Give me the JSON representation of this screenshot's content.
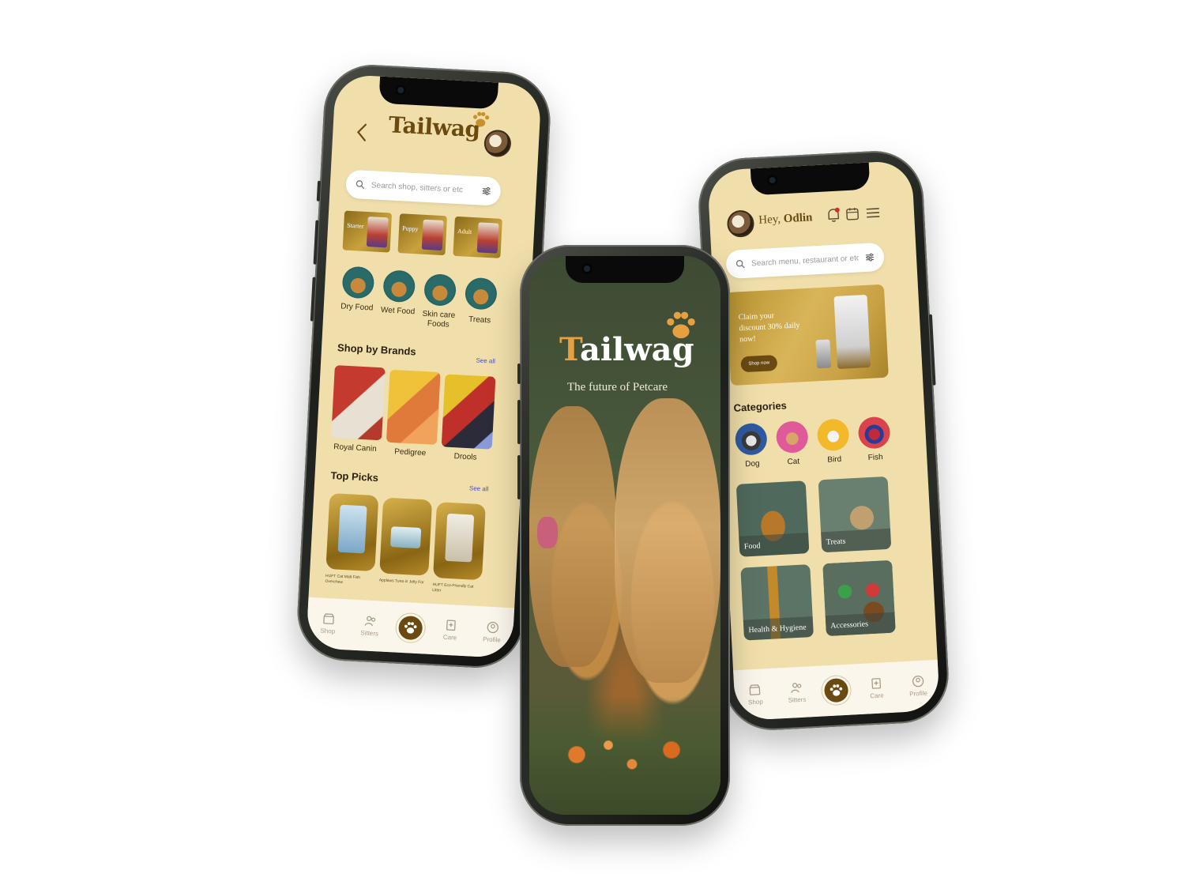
{
  "shop_screen": {
    "brand": "Tailwag",
    "search_placeholder": "Search shop, sitters or etc",
    "stages": [
      "Starter",
      "Puppy",
      "Adult"
    ],
    "food_categories": [
      "Dry Food",
      "Wet Food",
      "Skin care Foods",
      "Treats"
    ],
    "brands_section": {
      "title": "Shop by Brands",
      "see_all": "See all"
    },
    "brands": [
      "Royal Canin",
      "Pedigree",
      "Drools"
    ],
    "top_picks_section": {
      "title": "Top Picks",
      "see_all": "See all"
    },
    "top_picks": [
      "HUFT Cat Malt Fish Overchew",
      "Applaws Tuna in Jelly For",
      "HUFT Eco-Friendly Cat Litter"
    ]
  },
  "splash_screen": {
    "brand_first": "T",
    "brand_rest": "ailwag",
    "tagline": "The future of Petcare"
  },
  "home_screen": {
    "greeting_prefix": "Hey, ",
    "user_name": "Odlin",
    "search_placeholder": "Search menu, restaurant or etc",
    "promo": {
      "text": "Claim your discount 30% daily now!",
      "button": "Shop now"
    },
    "categories_title": "Categories",
    "pets": [
      "Dog",
      "Cat",
      "Bird",
      "Fish"
    ],
    "tiles": [
      "Food",
      "Treats",
      "Health & Hygiene",
      "Accessories"
    ]
  },
  "nav": [
    "Shop",
    "Sitters",
    "Care",
    "Profile"
  ],
  "colors": {
    "primary": "#6a4a10",
    "background": "#f1dfab",
    "accent": "#e6a040",
    "link": "#4b4fc9"
  }
}
